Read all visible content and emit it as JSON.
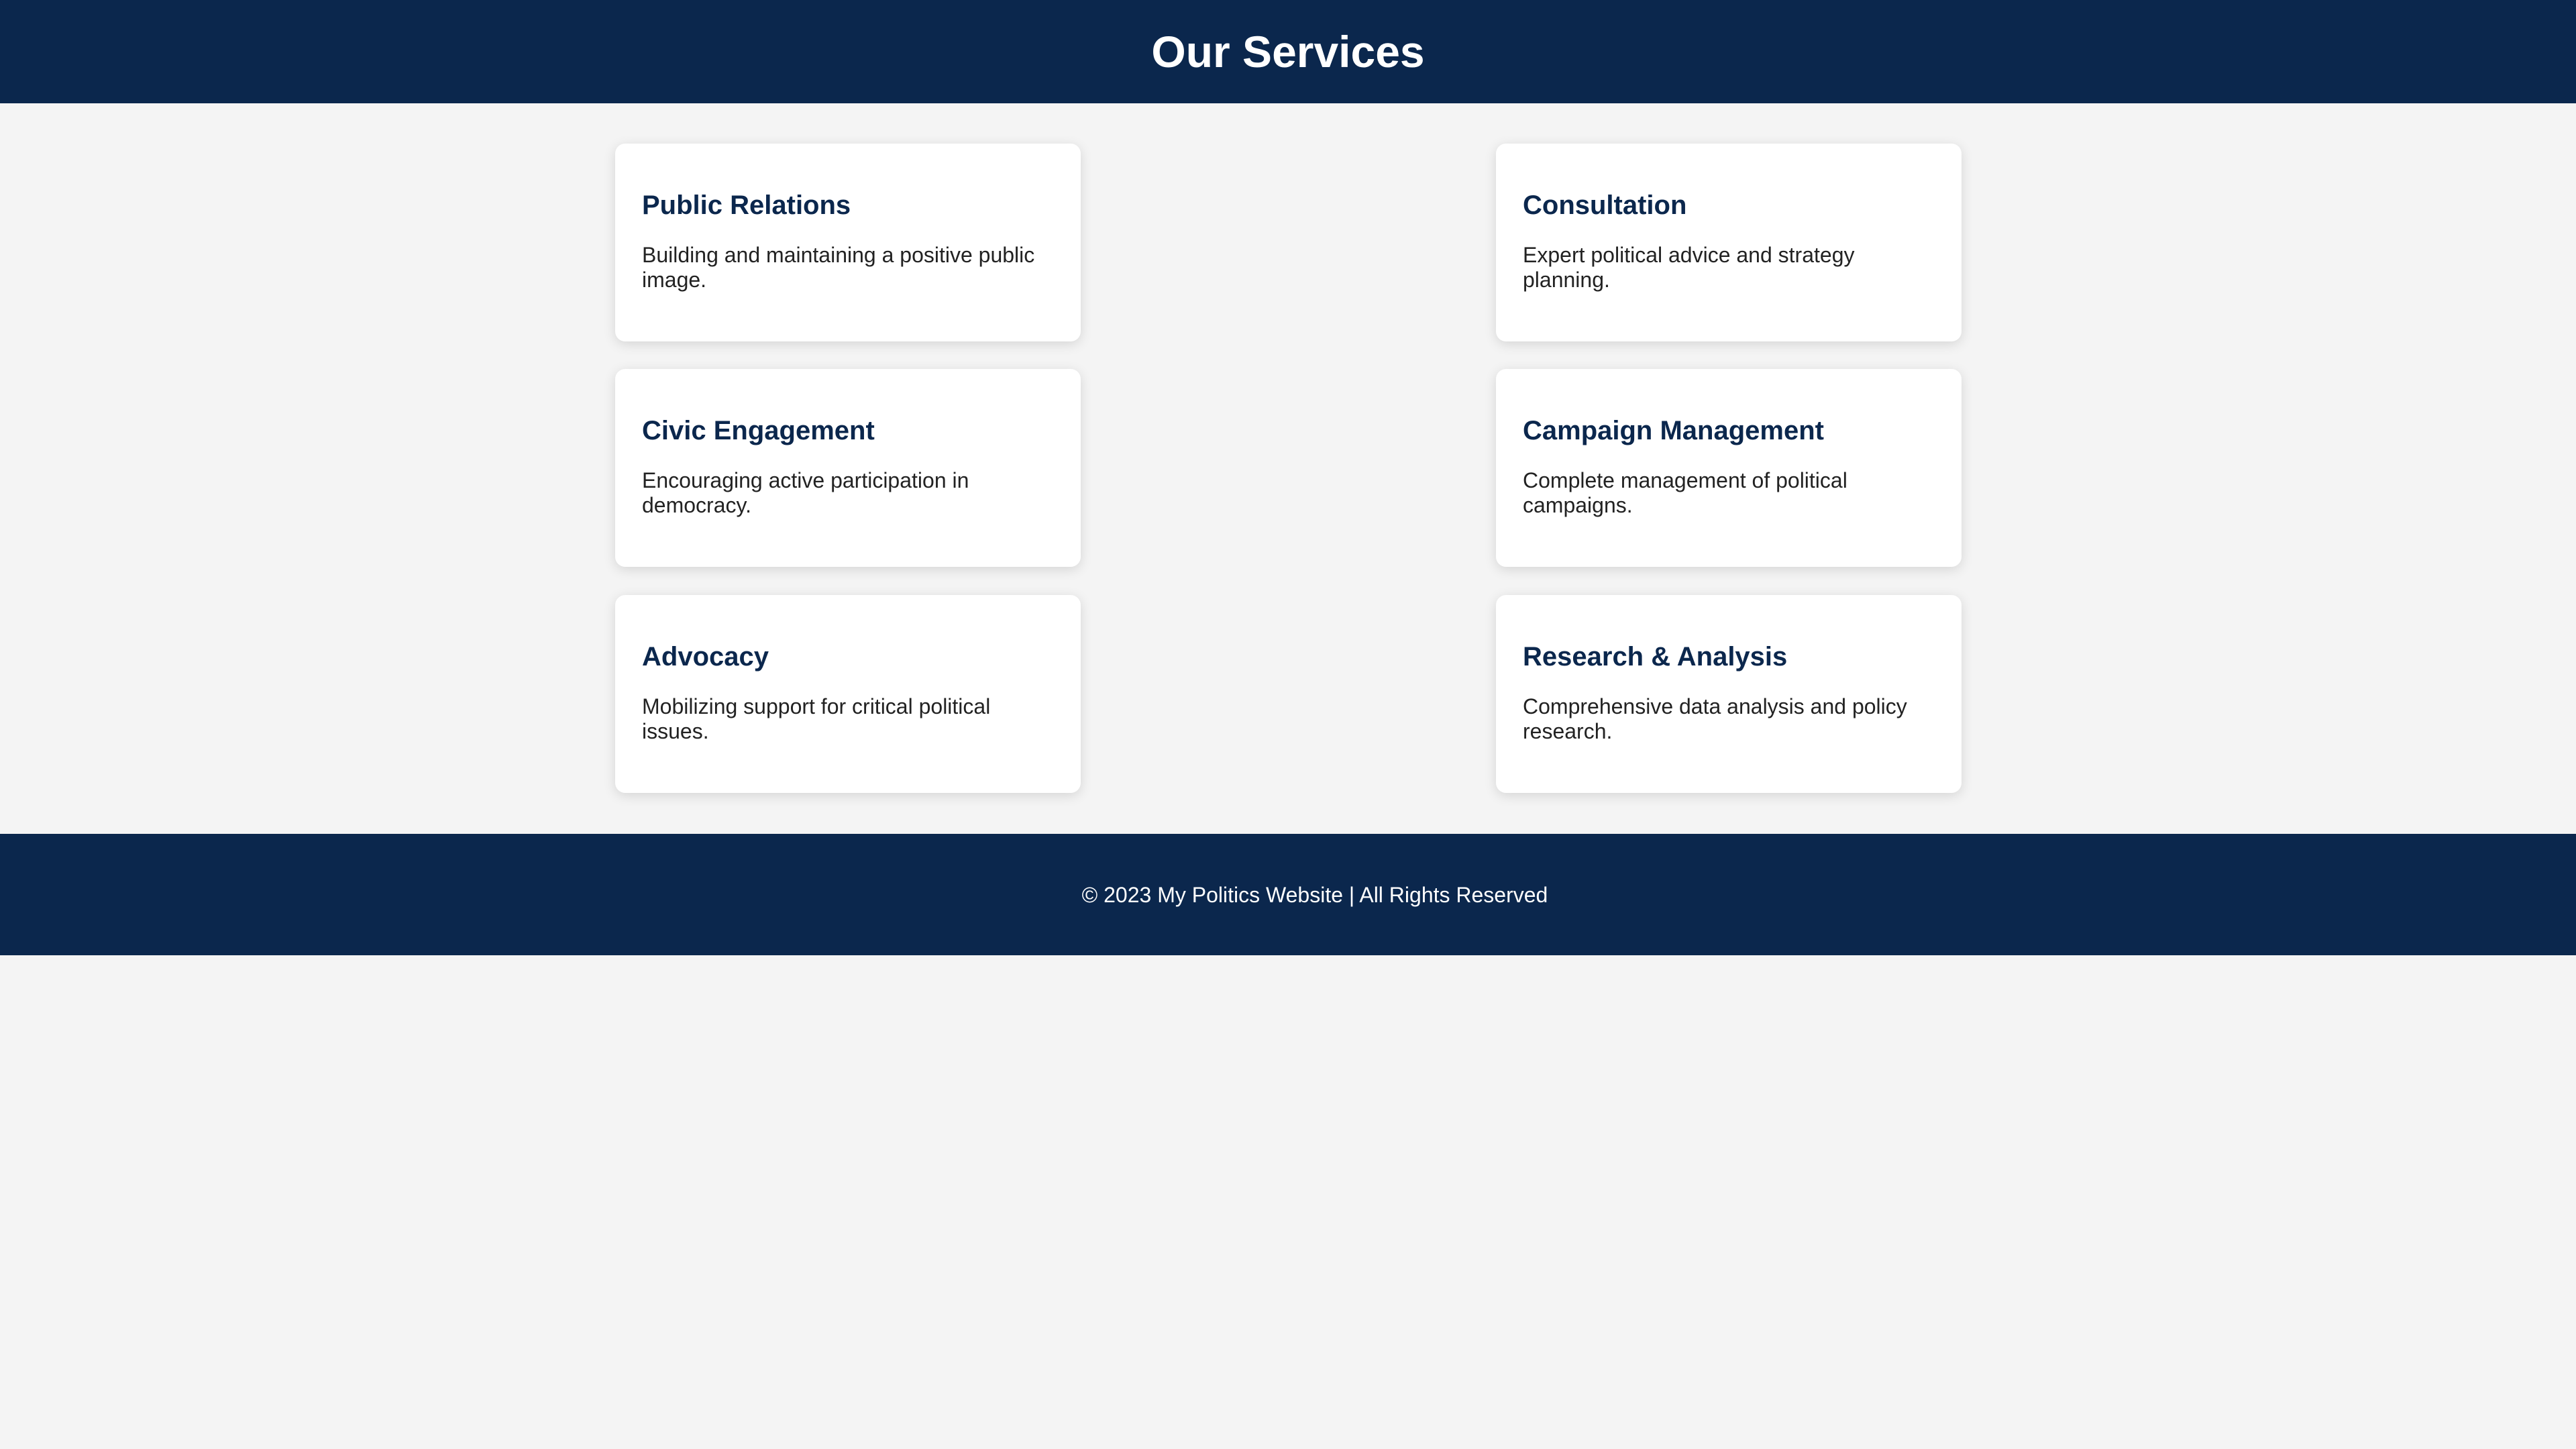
{
  "header": {
    "title": "Our Services"
  },
  "services": [
    {
      "title": "Public Relations",
      "description": "Building and maintaining a positive public image."
    },
    {
      "title": "Consultation",
      "description": "Expert political advice and strategy planning."
    },
    {
      "title": "Civic Engagement",
      "description": "Encouraging active participation in democracy."
    },
    {
      "title": "Campaign Management",
      "description": "Complete management of political campaigns."
    },
    {
      "title": "Advocacy",
      "description": "Mobilizing support for critical political issues."
    },
    {
      "title": "Research & Analysis",
      "description": "Comprehensive data analysis and policy research."
    }
  ],
  "footer": {
    "text": "© 2023 My Politics Website | All Rights Reserved"
  },
  "colors": {
    "header_bg": "#0b274d",
    "page_bg": "#f4f4f4",
    "card_bg": "#ffffff",
    "card_title": "#0b274d"
  }
}
